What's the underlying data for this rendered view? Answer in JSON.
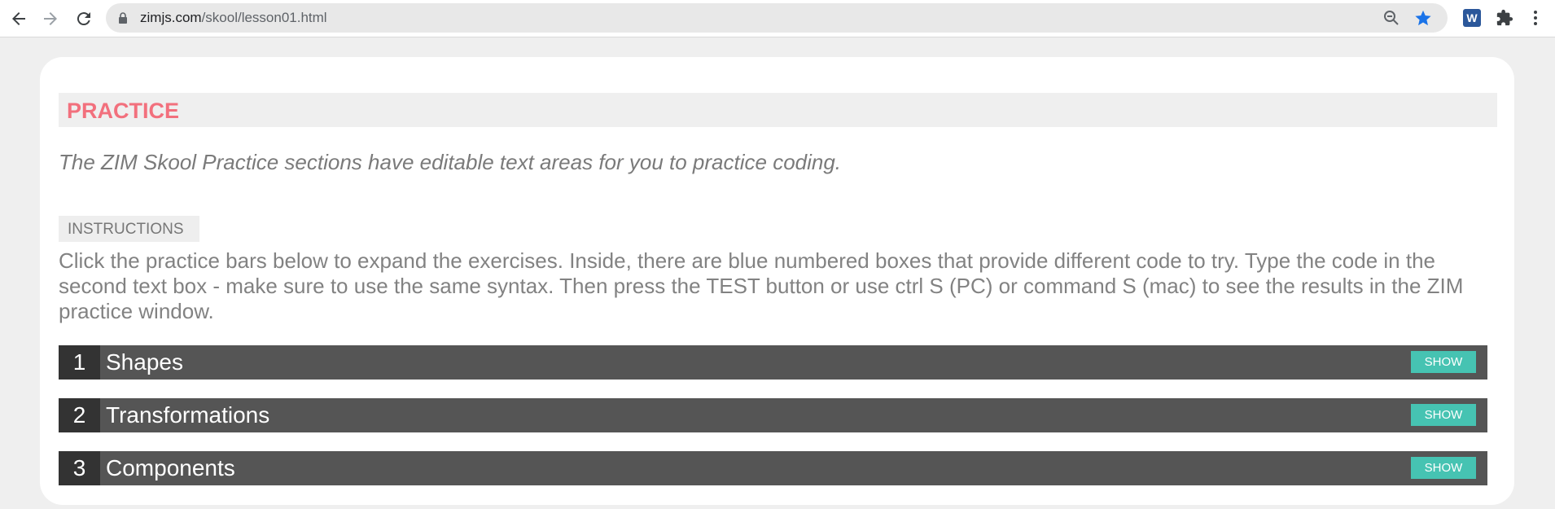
{
  "browser": {
    "url_domain": "zimjs.com",
    "url_path": "/skool/lesson01.html",
    "icons": [
      "back-arrow-icon",
      "forward-arrow-icon",
      "reload-icon",
      "lock-icon",
      "zoom-out-icon",
      "bookmark-star-icon",
      "word-extension-icon",
      "extensions-puzzle-icon",
      "menu-dots-icon"
    ],
    "word_extension_letter": "W",
    "accent_color": "#1a73e8"
  },
  "section": {
    "title": "PRACTICE",
    "title_color": "#f2707d"
  },
  "intro": "The ZIM Skool Practice sections have editable text areas for you to practice coding.",
  "instructions": {
    "label": "INSTRUCTIONS",
    "text": "Click the practice bars below to expand the exercises. Inside, there are blue numbered boxes that provide different code to try. Type the code in the second text box - make sure to use the same syntax. Then press the TEST button or use ctrl S (PC) or command S (mac) to see the results in the ZIM practice window."
  },
  "practices": [
    {
      "number": "1",
      "title": "Shapes",
      "button": "SHOW"
    },
    {
      "number": "2",
      "title": "Transformations",
      "button": "SHOW"
    },
    {
      "number": "3",
      "title": "Components",
      "button": "SHOW"
    }
  ],
  "colors": {
    "show_button": "#46c3b2",
    "practice_bar": "#555555",
    "practice_number_box": "#333333"
  }
}
